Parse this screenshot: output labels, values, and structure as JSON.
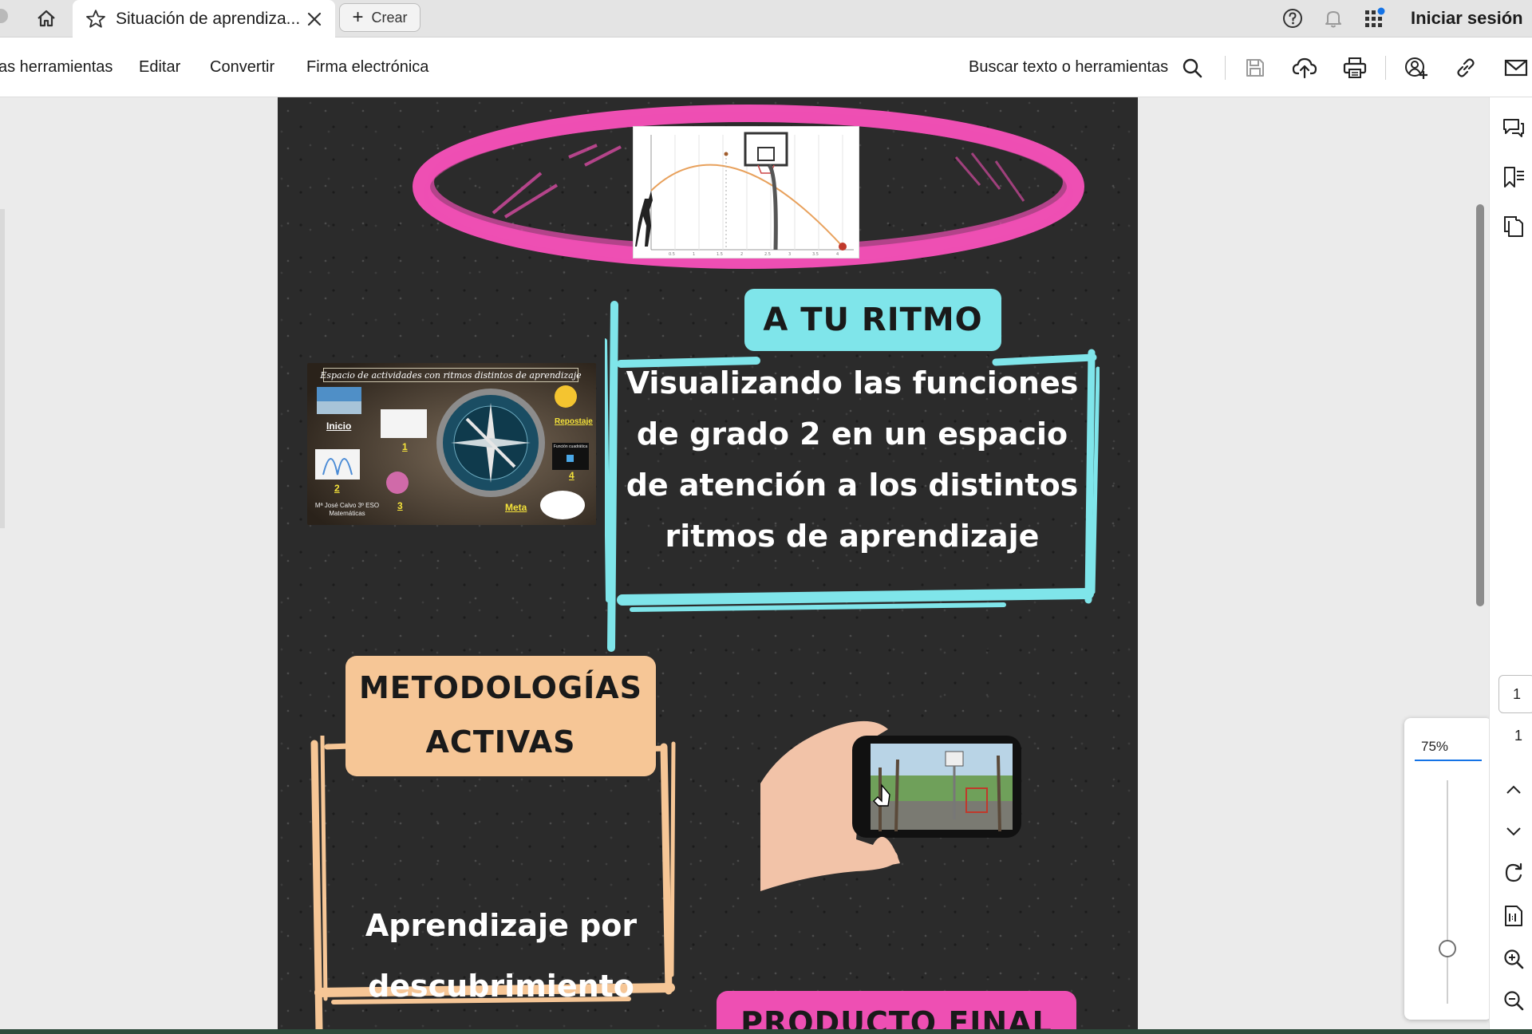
{
  "browser": {
    "tab_title": "Situación de aprendiza...",
    "create_label": "Crear",
    "signin_label": "Iniciar sesión"
  },
  "menu": {
    "tools": "as herramientas",
    "edit": "Editar",
    "convert": "Convertir",
    "esign": "Firma electrónica",
    "search_label": "Buscar texto o herramientas"
  },
  "page": {
    "ritmo_title": "A TU RITMO",
    "ritmo_text": "Visualizando las funciones de grado 2 en un espacio de atención a los distintos ritmos de aprendizaje",
    "compass_banner": "Espacio de actividades con ritmos distintos de aprendizaje",
    "compass_labels": {
      "inicio": "Inicio",
      "repostaje": "Repostaje",
      "n1": "1",
      "n2": "2",
      "n3": "3",
      "n4": "4",
      "meta": "Meta",
      "author": "Mª José Calvo 3º ESO Matemáticas",
      "funcion": "Función cuadrática"
    },
    "meto_title_1": "METODOLOGÍAS",
    "meto_title_2": "ACTIVAS",
    "meto_text_1": "Aprendizaje por",
    "meto_text_2": "descubrimiento",
    "producto_title": "PRODUCTO FINAL"
  },
  "zoom": {
    "value": "75%",
    "level_percent": 75
  },
  "pagination": {
    "current": "1",
    "total": "1"
  },
  "icons": {
    "home": "home-icon",
    "star": "star-icon",
    "close": "close-icon",
    "help": "help-icon",
    "bell": "bell-icon",
    "apps": "apps-icon",
    "search": "search-icon",
    "save": "save-icon",
    "upload": "cloud-upload-icon",
    "print": "print-icon",
    "share": "share-user-icon",
    "link": "link-icon",
    "mail": "mail-icon",
    "comment": "comment-icon",
    "bookmark": "bookmark-icon",
    "pages": "pages-icon",
    "refresh": "rotate-icon",
    "fit": "fit-page-icon",
    "zoomin": "zoom-in-icon",
    "zoomout": "zoom-out-icon"
  },
  "colors": {
    "cyan": "#7fe5ea",
    "peach": "#f6c696",
    "magenta": "#ee4fb3",
    "board": "#2b2b2b",
    "accent": "#1473e6"
  }
}
